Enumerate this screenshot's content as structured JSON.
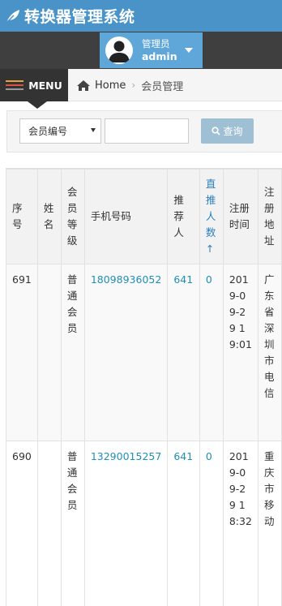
{
  "app": {
    "title": "转换器管理系统"
  },
  "user": {
    "role": "管理员",
    "name": "admin"
  },
  "nav": {
    "menu_label": "MENU",
    "home": "Home",
    "separator": "›",
    "current": "会员管理"
  },
  "search": {
    "field_selected": "会员编号",
    "query_value": "",
    "button_label": "查询"
  },
  "table": {
    "headers": [
      "序号",
      "姓名",
      "会员等级",
      "手机号码",
      "推荐人",
      "直推人数↑",
      "注册时间",
      "注册地址"
    ],
    "rows": [
      {
        "id": "691",
        "name": "",
        "level": "普通会员",
        "phone": "18098936052",
        "referrer": "641",
        "direct": "0",
        "reg_time": "2019-09-29 19:01",
        "address": "广东省深圳市电信"
      },
      {
        "id": "690",
        "name": "",
        "level": "普通会员",
        "phone": "13290015257",
        "referrer": "641",
        "direct": "0",
        "reg_time": "2019-09-29 18:32",
        "address": "重庆市移动"
      }
    ]
  }
}
